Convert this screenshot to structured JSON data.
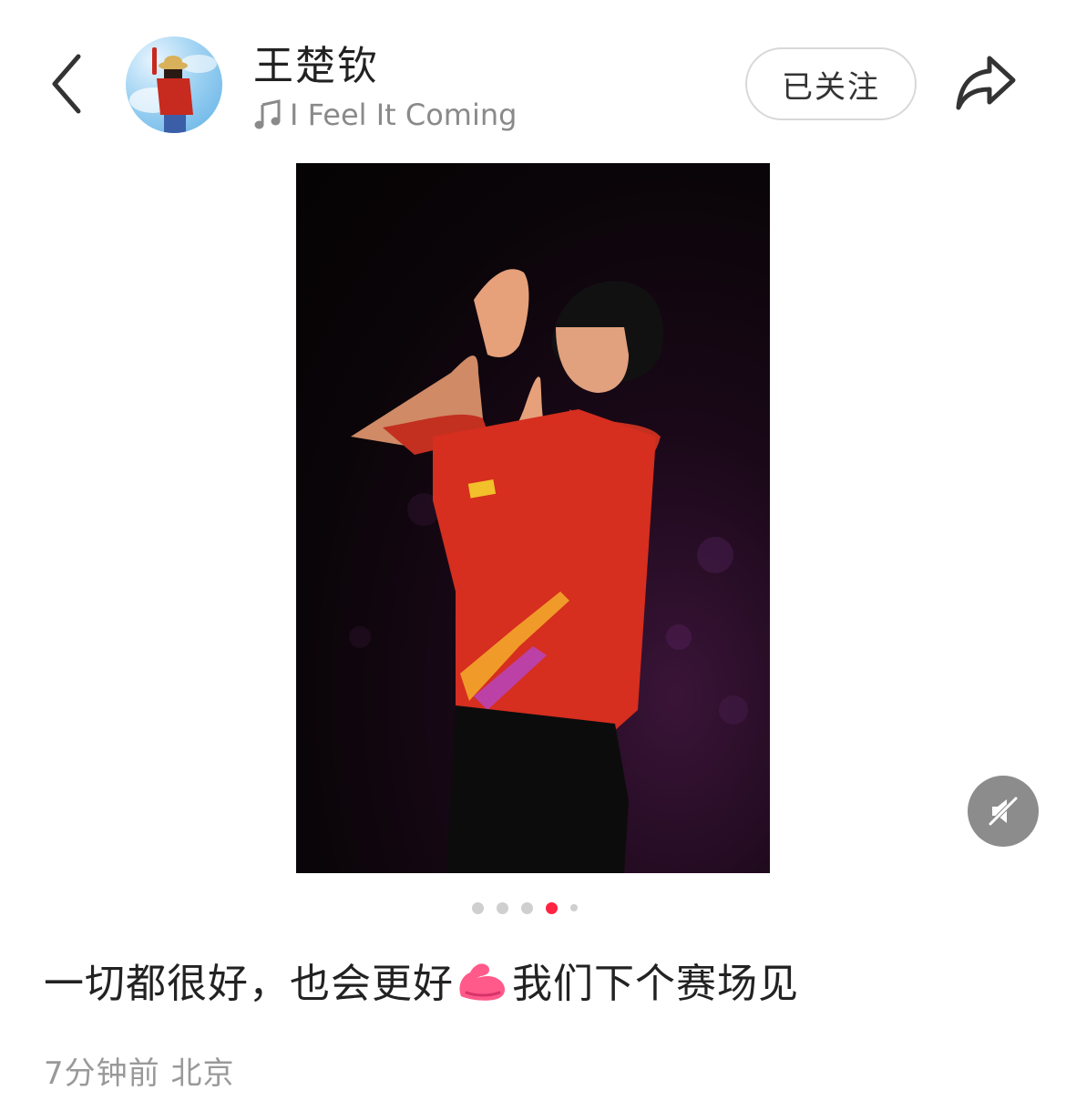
{
  "header": {
    "author_name": "王楚钦",
    "music_title": "I Feel It Coming",
    "follow_label": "已关注",
    "icons": {
      "back": "chevron-left-icon",
      "music": "music-note-icon",
      "share": "share-arrow-icon"
    }
  },
  "media": {
    "image_count": 5,
    "current_index": 4,
    "mute_icon": "sound-off-icon",
    "accent_color": "#ff2442"
  },
  "post": {
    "caption_before_emoji": "一切都很好，也会更好",
    "caption_emoji": "flexed-biceps-emoji",
    "caption_after_emoji": "我们下个赛场见",
    "time": "7分钟前",
    "location": "北京"
  }
}
